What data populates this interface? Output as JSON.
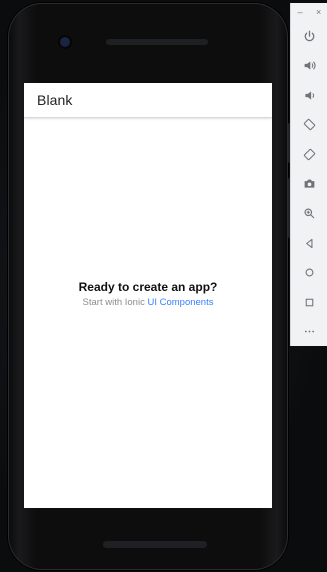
{
  "app": {
    "toolbar_title": "Blank"
  },
  "empty_state": {
    "headline": "Ready to create an app?",
    "subline_prefix": "Start with Ionic",
    "link_text": "UI Components"
  },
  "emulator_panel": {
    "window_minimize": "–",
    "window_close": "×",
    "buttons": [
      {
        "icon": "power-icon"
      },
      {
        "icon": "volume-up-icon"
      },
      {
        "icon": "volume-down-icon"
      },
      {
        "icon": "rotate-left-icon"
      },
      {
        "icon": "rotate-right-icon"
      },
      {
        "icon": "camera-icon"
      },
      {
        "icon": "zoom-icon"
      },
      {
        "icon": "back-icon"
      },
      {
        "icon": "home-icon"
      },
      {
        "icon": "overview-icon"
      },
      {
        "icon": "more-icon"
      }
    ]
  },
  "colors": {
    "link": "#3880ff",
    "toolbar_bg": "#ffffff",
    "phone_body": "#0d0d0e",
    "panel_bg": "#f1f2f4"
  }
}
